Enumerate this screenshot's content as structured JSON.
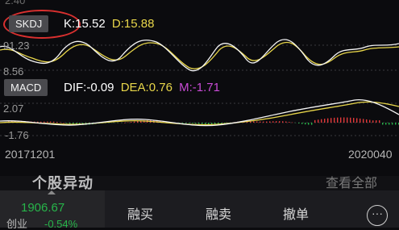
{
  "skdj": {
    "tag": "SKDJ",
    "k_text": "K:15.52",
    "d_text": "D:15.88",
    "k_color": "#ffffff",
    "d_color": "#e8d64a",
    "top_label": "2.40",
    "y_high": "91.23",
    "y_low": "8.56"
  },
  "macd": {
    "tag": "MACD",
    "dif_text": "DIF:-0.09",
    "dea_text": "DEA:0.76",
    "m_text": "M:-1.71",
    "dif_color": "#ffffff",
    "dea_color": "#e8d64a",
    "m_color": "#c94bd6",
    "y_high": "2.07",
    "y_low": "-1.76"
  },
  "dates": {
    "start": "20171201",
    "end": "2020040"
  },
  "colors": {
    "up": "#e0393a",
    "down": "#27b54a",
    "grid": "#3a3a3e"
  },
  "section": {
    "title": "个股异动",
    "see_all": "查看全部"
  },
  "index_widget": {
    "value": "1906.67",
    "name": "创业",
    "change": "-0.54%"
  },
  "actions": {
    "margin_buy": "融买",
    "margin_sell": "融卖",
    "cancel_order": "撤单",
    "more_icon": "more-icon"
  }
}
